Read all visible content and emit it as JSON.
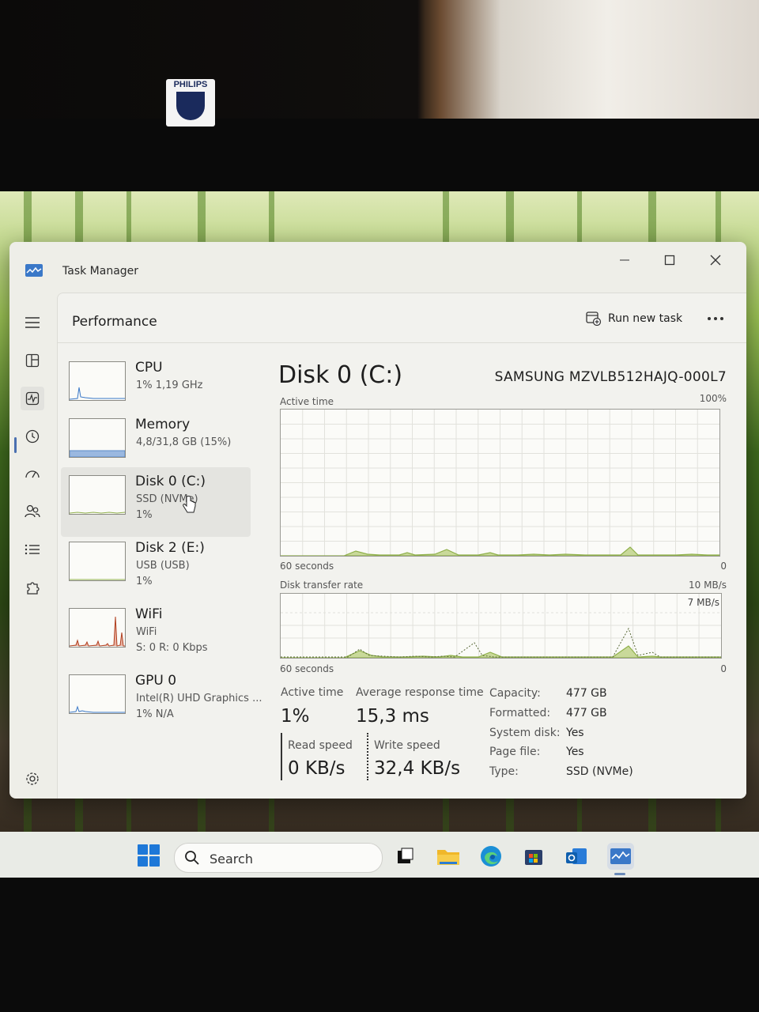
{
  "monitor": {
    "brand": "PHILIPS"
  },
  "window": {
    "title": "Task Manager"
  },
  "header": {
    "page_title": "Performance",
    "run_task_label": "Run new task"
  },
  "devices": [
    {
      "name": "CPU",
      "sub1": "1% 1,19 GHz",
      "sub2": ""
    },
    {
      "name": "Memory",
      "sub1": "4,8/31,8 GB (15%)",
      "sub2": ""
    },
    {
      "name": "Disk 0 (C:)",
      "sub1": "SSD (NVMe)",
      "sub2": "1%"
    },
    {
      "name": "Disk 2 (E:)",
      "sub1": "USB (USB)",
      "sub2": "1%"
    },
    {
      "name": "WiFi",
      "sub1": "WiFi",
      "sub2": "S: 0 R: 0 Kbps"
    },
    {
      "name": "GPU 0",
      "sub1": "Intel(R) UHD Graphics ...",
      "sub2": "1% N/A"
    }
  ],
  "detail": {
    "title": "Disk 0 (C:)",
    "model": "SAMSUNG MZVLB512HAJQ-000L7",
    "active_graph": {
      "label": "Active time",
      "max_label": "100%",
      "time_label": "60 seconds",
      "min_label": "0"
    },
    "transfer_graph": {
      "label": "Disk transfer rate",
      "max_label": "10 MB/s",
      "inner_label": "7 MB/s",
      "time_label": "60 seconds",
      "min_label": "0"
    },
    "stats": {
      "active_time_label": "Active time",
      "active_time_value": "1%",
      "avg_response_label": "Average response time",
      "avg_response_value": "15,3 ms",
      "read_label": "Read speed",
      "read_value": "0 KB/s",
      "write_label": "Write speed",
      "write_value": "32,4 KB/s"
    },
    "properties": [
      {
        "label": "Capacity:",
        "value": "477 GB"
      },
      {
        "label": "Formatted:",
        "value": "477 GB"
      },
      {
        "label": "System disk:",
        "value": "Yes"
      },
      {
        "label": "Page file:",
        "value": "Yes"
      },
      {
        "label": "Type:",
        "value": "SSD (NVMe)"
      }
    ]
  },
  "taskbar": {
    "search_placeholder": "Search"
  },
  "colors": {
    "disk_green": "#8fb04a",
    "accent": "#4a6fb0",
    "memory_blue": "#5a8ac8"
  }
}
